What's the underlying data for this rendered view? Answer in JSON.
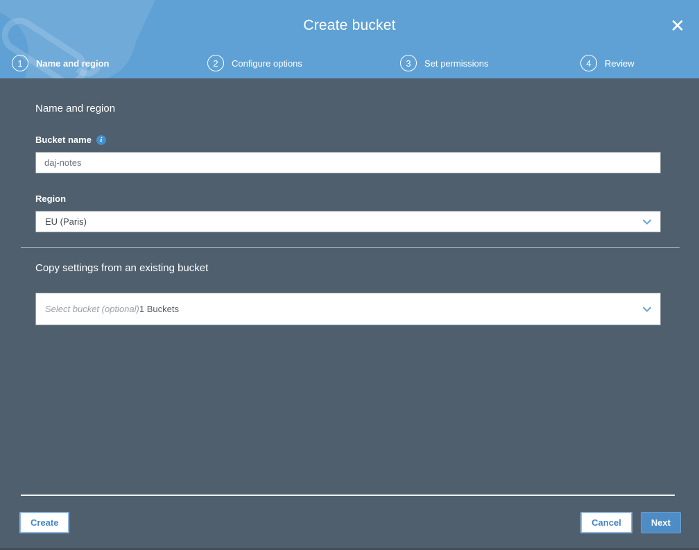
{
  "colors": {
    "header_blue": "#5FA1D5",
    "body_slate": "#4F5F6D",
    "accent_blue": "#4E8CC5",
    "info_icon_blue": "#4191CF",
    "chevron_blue": "#69A3D9",
    "bottom_strip": "#434E59"
  },
  "header": {
    "title": "Create bucket",
    "close_glyph": "✕"
  },
  "steps": [
    {
      "num": "1",
      "label": "Name and region",
      "active": true
    },
    {
      "num": "2",
      "label": "Configure options",
      "active": false
    },
    {
      "num": "3",
      "label": "Set permissions",
      "active": false
    },
    {
      "num": "4",
      "label": "Review",
      "active": false
    }
  ],
  "form": {
    "section_title": "Name and region",
    "bucket_name": {
      "label": "Bucket name",
      "info_glyph": "i",
      "value": "daj-notes"
    },
    "region": {
      "label": "Region",
      "value": "EU (Paris)"
    },
    "copy_settings": {
      "title": "Copy settings from an existing bucket",
      "placeholder": "Select bucket (optional)",
      "suffix": "1 Buckets"
    }
  },
  "footer": {
    "create_label": "Create",
    "cancel_label": "Cancel",
    "next_label": "Next"
  }
}
